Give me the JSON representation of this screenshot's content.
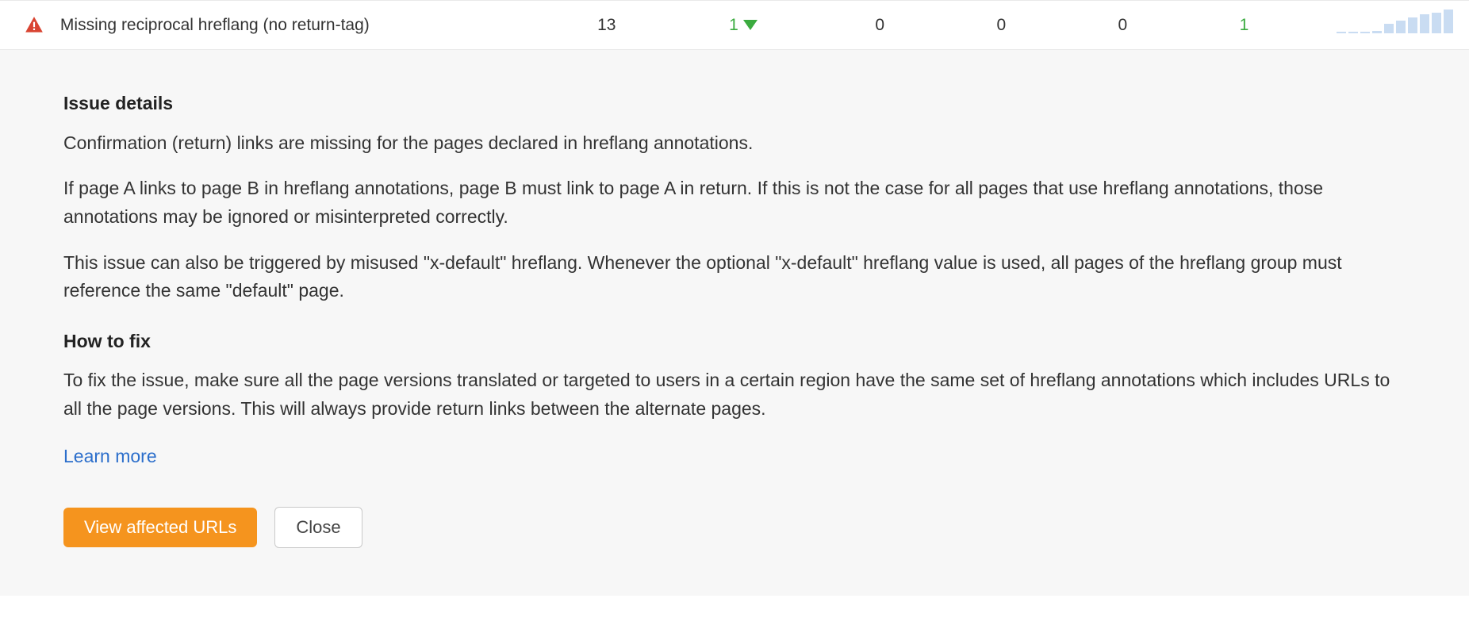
{
  "row": {
    "title": "Missing reciprocal hreflang (no return-tag)",
    "crawled": "13",
    "change_value": "1",
    "added": "0",
    "new": "0",
    "removed": "0",
    "missing": "1",
    "sparkline": [
      2,
      2,
      2,
      3,
      12,
      16,
      20,
      24,
      26,
      30
    ]
  },
  "details": {
    "heading": "Issue details",
    "p1": "Confirmation (return) links are missing for the pages declared in hreflang annotations.",
    "p2": "If page A links to page B in hreflang annotations, page B must link to page A in return. If this is not the case for all pages that use hreflang annotations, those annotations may be ignored or misinterpreted correctly.",
    "p3": "This issue can also be triggered by misused \"x-default\" hreflang. Whenever the optional \"x-default\" hreflang value is used, all pages of the hreflang group must reference the same \"default\" page."
  },
  "fix": {
    "heading": "How to fix",
    "p1": "To fix the issue, make sure all the page versions translated or targeted to users in a certain region have the same set of hreflang annotations which includes URLs to all the page versions. This will always provide return links between the alternate pages.",
    "learn_more": "Learn more"
  },
  "buttons": {
    "primary": "View affected URLs",
    "secondary": "Close"
  }
}
